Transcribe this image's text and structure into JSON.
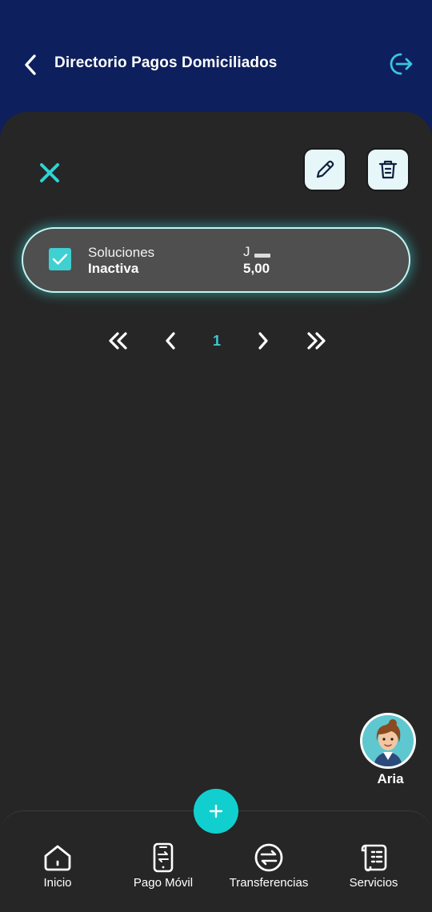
{
  "header": {
    "title": "Directorio Pagos Domiciliados",
    "back_icon": "chevron-left-icon",
    "logout_icon": "logout-icon"
  },
  "toolbar": {
    "close_icon": "close-icon",
    "edit_icon": "pencil-icon",
    "delete_icon": "trash-icon"
  },
  "items": [
    {
      "name": "Soluciones",
      "status": "Inactiva",
      "code": "J",
      "amount": "5,00",
      "checked": true
    }
  ],
  "pagination": {
    "current_page": "1",
    "first_icon": "double-chevron-left-icon",
    "prev_icon": "chevron-left-icon",
    "next_icon": "chevron-right-icon",
    "last_icon": "double-chevron-right-icon"
  },
  "assistant": {
    "name": "Aria"
  },
  "fab": {
    "icon": "plus-icon"
  },
  "bottom_nav": [
    {
      "label": "Inicio",
      "icon": "home-icon"
    },
    {
      "label": "Pago Móvil",
      "icon": "mobile-payment-icon"
    },
    {
      "label": "Transferencias",
      "icon": "transfer-icon"
    },
    {
      "label": "Servicios",
      "icon": "scroll-icon"
    }
  ],
  "colors": {
    "header_bg": "#0d1f5c",
    "surface": "#262626",
    "accent": "#12cfcf",
    "card_bg": "#4f4f4f"
  }
}
